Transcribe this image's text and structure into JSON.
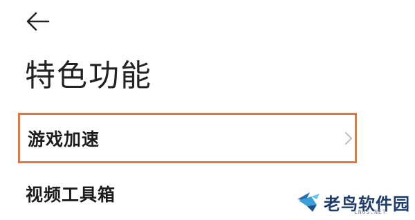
{
  "header": {
    "back_icon": "arrow-left-icon",
    "title": "特色功能"
  },
  "menu": {
    "items": [
      {
        "label": "游戏加速",
        "icon": "chevron-right-icon",
        "highlighted": true
      },
      {
        "label": "视频工具箱"
      }
    ]
  },
  "colors": {
    "highlight_border": "#e8743f",
    "text": "#1c1c1c",
    "background": "#ffffff",
    "watermark_text": "#1d3c6e"
  },
  "watermark": {
    "text": "老鸟软件园",
    "subtext": "LNUS.NET",
    "icon": "bird-logo-icon"
  }
}
